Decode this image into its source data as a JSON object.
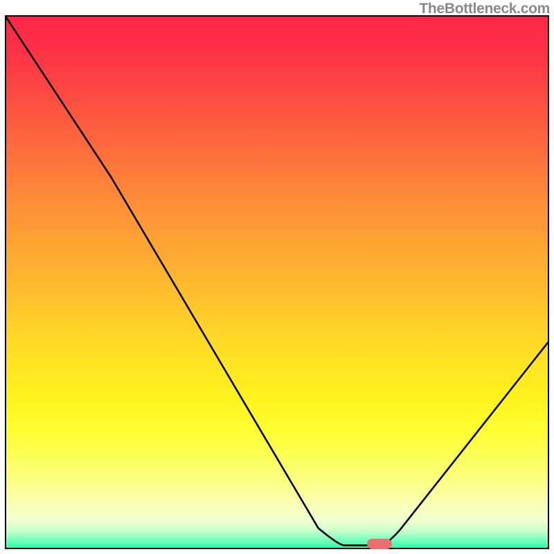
{
  "watermark": "TheBottleneck.com",
  "chart_data": {
    "type": "line",
    "title": "",
    "xlabel": "",
    "ylabel": "",
    "background_gradient": {
      "top": "#fd2846",
      "upper_mid": "#fe8a38",
      "mid": "#fec12c",
      "lower_mid": "#feff33",
      "bottom": "#2bffac"
    },
    "x_range_frac": [
      0.0,
      1.0
    ],
    "y_range_frac": [
      0.0,
      1.0
    ],
    "series": [
      {
        "name": "curve",
        "note": "Coordinates are fractional (0–1) within the plot box, origin top-left. Y=1 is the bottom (best/green).",
        "points": [
          {
            "x": 0.0,
            "y": 0.0
          },
          {
            "x": 0.195,
            "y": 0.303
          },
          {
            "x": 0.614,
            "y": 0.993
          },
          {
            "x": 0.7,
            "y": 0.993
          },
          {
            "x": 1.0,
            "y": 0.61
          }
        ]
      }
    ],
    "marker": {
      "color": "#e9706f",
      "x_frac": 0.688,
      "y_frac": 0.989,
      "shape": "rounded-rect"
    },
    "axes_visible": false,
    "grid": false
  }
}
